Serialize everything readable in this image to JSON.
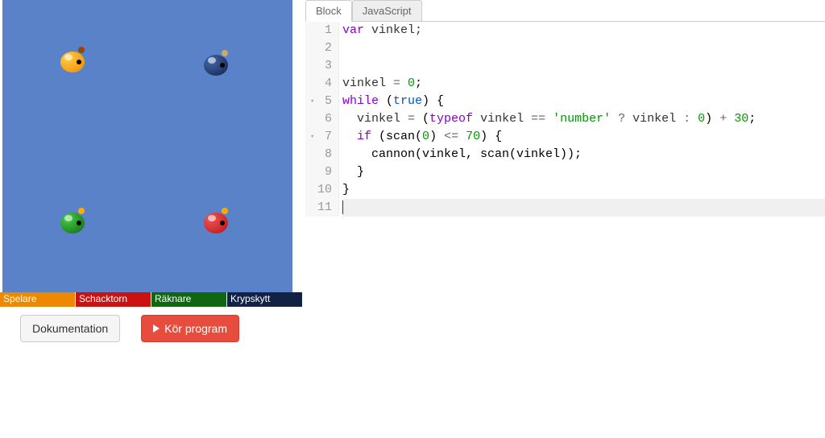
{
  "status": {
    "s0": "Spelare",
    "s1": "Schacktorn",
    "s2": "Räknare",
    "s3": "Krypskytt"
  },
  "buttons": {
    "docs": "Dokumentation",
    "run": "Kör program"
  },
  "tabs": {
    "block": "Block",
    "js": "JavaScript"
  },
  "gutter": {
    "l1": "1",
    "l2": "2",
    "l3": "3",
    "l4": "4",
    "l5": "5",
    "l6": "6",
    "l7": "7",
    "l8": "8",
    "l9": "9",
    "l10": "10",
    "l11": "11"
  },
  "code": {
    "l1": {
      "a": "var",
      "b": " vinkel;"
    },
    "l2": "",
    "l3": "",
    "l4": {
      "a": "vinkel ",
      "b": "= ",
      "c": "0",
      "d": ";"
    },
    "l5": {
      "a": "while",
      "b": " (",
      "c": "true",
      "d": ") {"
    },
    "l6": {
      "a": "  vinkel ",
      "b": "= ",
      "c": "(",
      "d": "typeof",
      "e": " vinkel ",
      "f": "== ",
      "g": "'number'",
      "h": " ? ",
      "i": "vinkel ",
      "j": ": ",
      "k": "0",
      "l": ") ",
      "m": "+ ",
      "n": "30",
      "o": ";"
    },
    "l7": {
      "a": "  ",
      "b": "if",
      "c": " (scan(",
      "d": "0",
      "e": ") ",
      "f": "<= ",
      "g": "70",
      "h": ") {"
    },
    "l8": {
      "a": "    cannon(vinkel, scan(vinkel));"
    },
    "l9": "  }",
    "l10": "}"
  }
}
